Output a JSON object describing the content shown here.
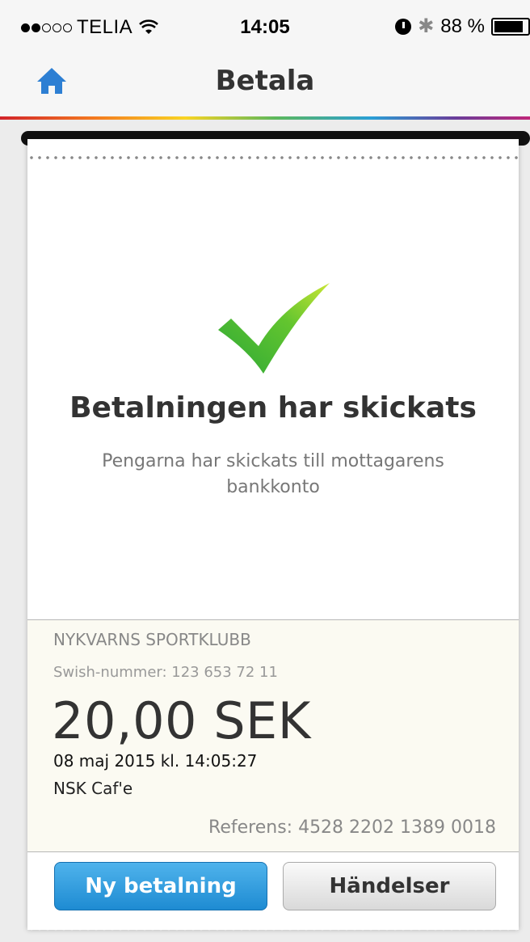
{
  "status_bar": {
    "carrier": "TELIA",
    "signal_bars_filled": 2,
    "signal_bars_total": 5,
    "time": "14:05",
    "battery_text": "88 %",
    "battery_level": 0.88
  },
  "nav": {
    "title": "Betala",
    "home_icon": "home-icon"
  },
  "receipt": {
    "success_title": "Betalningen har skickats",
    "success_message": "Pengarna har skickats till mottagarens bankkonto",
    "merchant": "NYKVARNS SPORTKLUBB",
    "swish_number": "Swish-nummer: 123 653 72 11",
    "amount": "20,00 SEK",
    "date": "08 maj 2015 kl. 14:05:27",
    "message": "NSK Caf'e",
    "reference": "Referens: 4528 2202 1389 0018"
  },
  "buttons": {
    "new_payment": "Ny betalning",
    "events": "Händelser"
  },
  "colors": {
    "primary_button": "#1e8bd2",
    "check_green": "#4cbf2f",
    "home_icon_blue": "#2d7fd3"
  }
}
